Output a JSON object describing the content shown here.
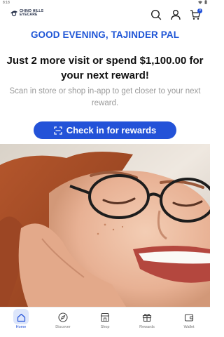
{
  "status_bar": {
    "time": "8:18"
  },
  "header": {
    "logo_line1": "CHINO HILLS",
    "logo_line2": "EYECARE",
    "cart_count": "0"
  },
  "greeting": "GOOD EVENING, TAJINDER PAL",
  "headline": "Just 2 more visit or spend $1,100.00 for your next reward!",
  "subtext": "Scan in store or shop in-app to get closer to your next reward.",
  "checkin_button": "Check in for rewards",
  "hero_image": {
    "alt": ""
  },
  "nav": {
    "items": [
      {
        "label": "Home",
        "icon": "home-icon",
        "active": true
      },
      {
        "label": "Discover",
        "icon": "compass-icon",
        "active": false
      },
      {
        "label": "Shop",
        "icon": "store-icon",
        "active": false
      },
      {
        "label": "Rewards",
        "icon": "gift-icon",
        "active": false
      },
      {
        "label": "Wallet",
        "icon": "wallet-icon",
        "active": false
      }
    ]
  },
  "colors": {
    "accent": "#2352d8",
    "greeting": "#1e55d6",
    "nav_active_bg": "#dde6fb"
  }
}
